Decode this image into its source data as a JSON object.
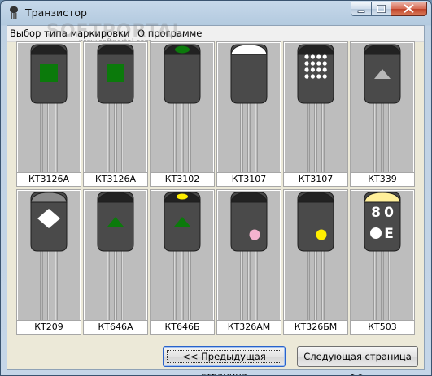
{
  "window": {
    "title": "Транзистор",
    "controls": [
      "minimize",
      "maximize",
      "close"
    ]
  },
  "menu": {
    "items": [
      "Выбор типа маркировки",
      "О программе"
    ]
  },
  "watermark": {
    "text": "SOFTPORTAL",
    "url": "www.softportal.com"
  },
  "transistors": [
    {
      "label": "КТ3126А",
      "marking": "green-square",
      "cap_color": "#222222",
      "mark_color": "#0b7a0b"
    },
    {
      "label": "КТ3126А",
      "marking": "green-square",
      "cap_color": "#222222",
      "mark_color": "#0b7a0b"
    },
    {
      "label": "КТ3102",
      "marking": "green-oval-top",
      "cap_color": "#222222",
      "mark_color": "#0b7a0b"
    },
    {
      "label": "КТ3107",
      "marking": "white-dome-top",
      "cap_color": "#ffffff",
      "mark_color": "#ffffff"
    },
    {
      "label": "КТ3107",
      "marking": "white-dot-grid",
      "cap_color": "#222222",
      "mark_color": "#ffffff"
    },
    {
      "label": "КТ339",
      "marking": "gray-triangle",
      "cap_color": "#222222",
      "mark_color": "#b8b8b8"
    },
    {
      "label": "КТ209",
      "marking": "white-diamond",
      "cap_color": "#8a8a8a",
      "mark_color": "#ffffff"
    },
    {
      "label": "КТ646А",
      "marking": "green-triangle",
      "cap_color": "#222222",
      "mark_color": "#0b7a0b"
    },
    {
      "label": "КТ646Б",
      "marking": "yellow-oval-green-triangle",
      "cap_color": "#222222",
      "mark_color": "#ffee00"
    },
    {
      "label": "КТ326АМ",
      "marking": "pink-dot",
      "cap_color": "#222222",
      "mark_color": "#f4b3cf"
    },
    {
      "label": "КТ326БМ",
      "marking": "yellow-dot",
      "cap_color": "#222222",
      "mark_color": "#ffee00"
    },
    {
      "label": "КТ503",
      "marking": "code-80E",
      "cap_color": "#ffef99",
      "mark_color": "#ffffff",
      "code_text": [
        "8",
        "0",
        "Е"
      ]
    }
  ],
  "buttons": {
    "prev": "<< Предыдущая страница",
    "next": "Следующая страница >>"
  }
}
